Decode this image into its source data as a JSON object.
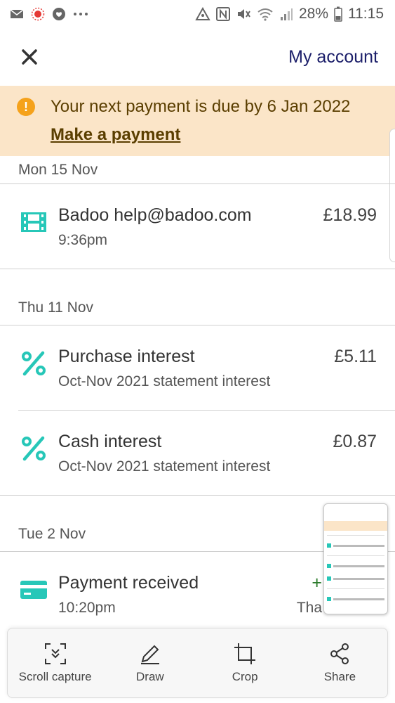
{
  "status_bar": {
    "battery_percent": "28%",
    "time": "11:15",
    "icons": [
      "mail-icon",
      "notification-icon",
      "heart-icon",
      "more-dots-icon",
      "sync-icon",
      "nfc-icon",
      "mute-icon",
      "wifi-icon",
      "signal-icon",
      "battery-icon"
    ]
  },
  "header": {
    "close_icon": "close-icon",
    "account_label": "My account"
  },
  "banner": {
    "message": "Your next payment is due by 6 Jan 2022",
    "link": "Make a payment",
    "bg_color": "#fbe5c8",
    "icon_color": "#f5a21b"
  },
  "transactions": {
    "groups": [
      {
        "date": "Mon 15 Nov",
        "items": [
          {
            "icon": "film-icon",
            "title": "Badoo help@badoo.com",
            "subtitle": "9:36pm",
            "amount": "£18.99"
          }
        ]
      },
      {
        "date": "Thu 11 Nov",
        "items": [
          {
            "icon": "percent-icon",
            "title": "Purchase interest",
            "subtitle": "Oct-Nov 2021 statement interest",
            "amount": "£5.11"
          },
          {
            "icon": "percent-icon",
            "title": "Cash interest",
            "subtitle": "Oct-Nov 2021 statement interest",
            "amount": "£0.87"
          }
        ]
      },
      {
        "date": "Tue 2 Nov",
        "items": [
          {
            "icon": "card-icon",
            "title": "Payment received",
            "subtitle": "10:20pm",
            "amount": "+",
            "amount_note": "Tha"
          }
        ]
      }
    ]
  },
  "accent_color": "#27c7b8",
  "toolbar": {
    "items": [
      {
        "icon": "scroll-capture-icon",
        "label": "Scroll capture"
      },
      {
        "icon": "pencil-icon",
        "label": "Draw"
      },
      {
        "icon": "crop-icon",
        "label": "Crop"
      },
      {
        "icon": "share-icon",
        "label": "Share"
      }
    ]
  }
}
